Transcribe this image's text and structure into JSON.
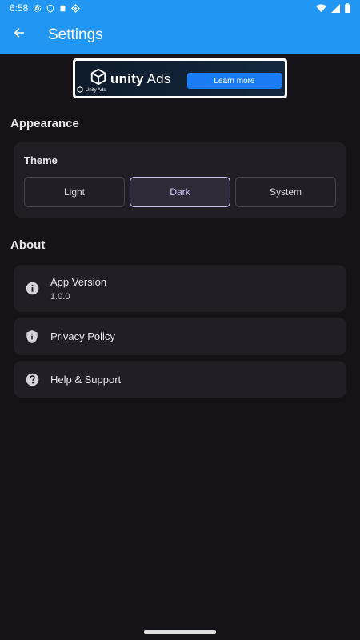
{
  "status_bar": {
    "time": "6:58"
  },
  "app_bar": {
    "title": "Settings"
  },
  "ad": {
    "brand": "unity",
    "brand_suffix": "Ads",
    "cta": "Learn more",
    "footer": "Unity Ads"
  },
  "appearance": {
    "section_title": "Appearance",
    "theme_label": "Theme",
    "options": [
      "Light",
      "Dark",
      "System"
    ],
    "selected": "Dark"
  },
  "about": {
    "section_title": "About",
    "items": [
      {
        "title": "App Version",
        "subtitle": "1.0.0",
        "icon": "info-icon"
      },
      {
        "title": "Privacy Policy",
        "icon": "shield-icon"
      },
      {
        "title": "Help & Support",
        "icon": "help-icon"
      }
    ]
  },
  "colors": {
    "app_bar": "#2196f3",
    "background": "#151218",
    "card": "#211e25",
    "selected_border": "#cfc3f3",
    "ad_cta": "#1a7cf5"
  }
}
